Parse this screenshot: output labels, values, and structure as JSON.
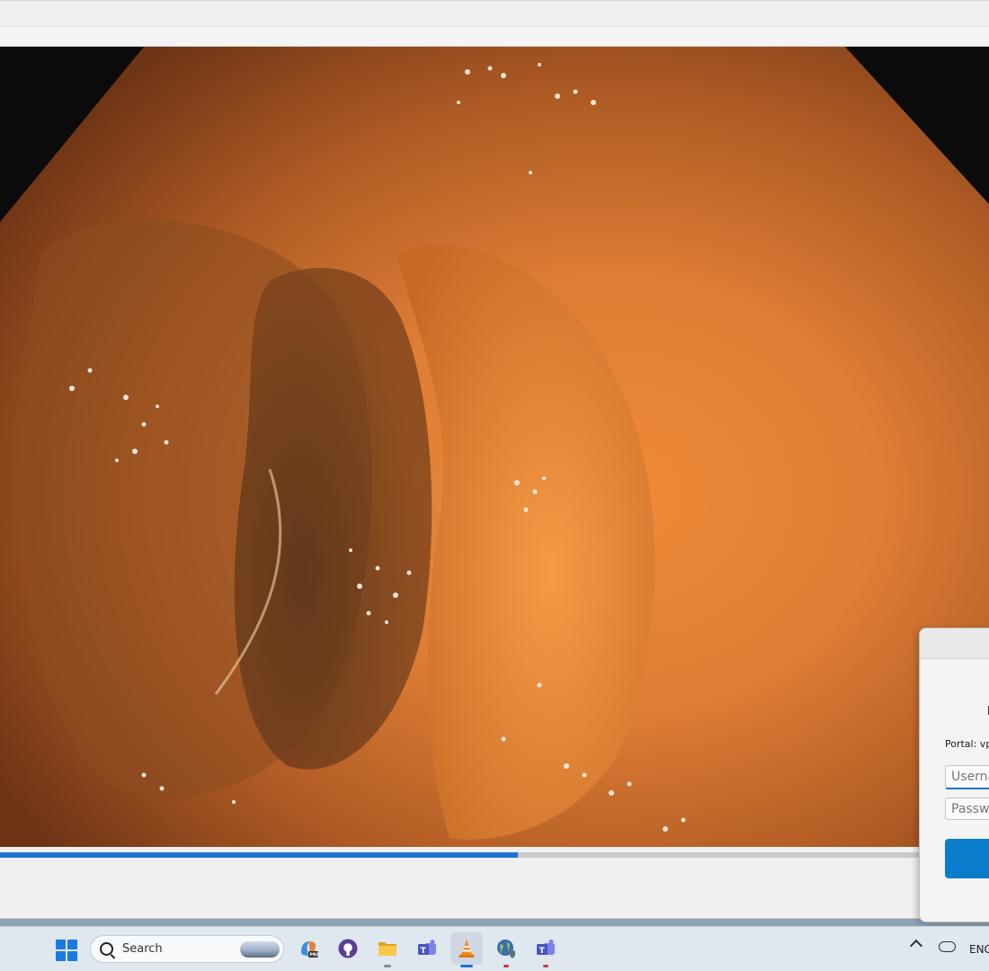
{
  "window": {
    "title": ""
  },
  "player": {
    "progress_fraction": 0.524
  },
  "dialog": {
    "portal_label": "Portal: vp",
    "username_placeholder": "Userna",
    "password_placeholder": "Passwo",
    "primary_button_label": ""
  },
  "taskbar": {
    "search_placeholder": "Search",
    "apps": [
      {
        "name": "copilot",
        "icon": "copilot-icon",
        "running": false
      },
      {
        "name": "github",
        "icon": "github-icon",
        "running": false
      },
      {
        "name": "file-explorer",
        "icon": "folder-icon",
        "running": true
      },
      {
        "name": "teams",
        "icon": "teams-icon",
        "running": false
      },
      {
        "name": "vlc",
        "icon": "vlc-cone-icon",
        "running": true,
        "active": true
      },
      {
        "name": "vpn-globe",
        "icon": "globe-shield-icon",
        "running": true,
        "alert": true
      },
      {
        "name": "teams-work",
        "icon": "teams-icon",
        "running": true,
        "alert": true
      }
    ],
    "tray": {
      "language": "ENG",
      "icons": [
        "chevron-up-icon",
        "onedrive-cloud-icon"
      ]
    }
  },
  "colors": {
    "accent": "#1f74d1",
    "taskbar": "#dfe7ef",
    "dialog_button": "#0a7ccc",
    "alert": "#d13438"
  }
}
